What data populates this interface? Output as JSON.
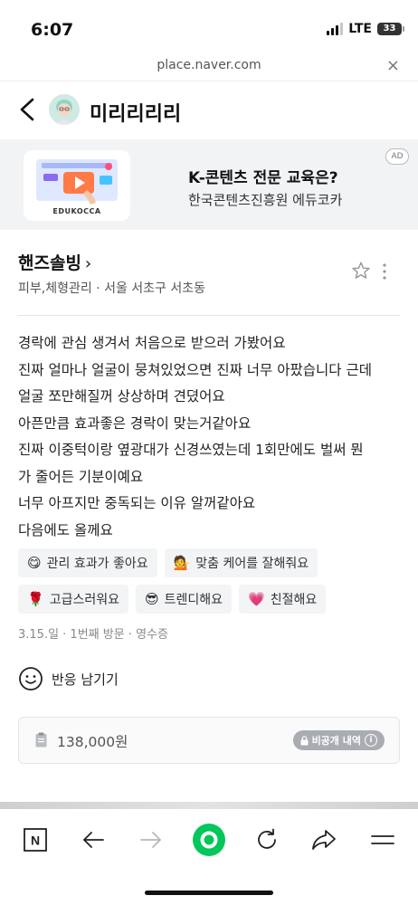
{
  "status_bar": {
    "time": "6:07",
    "network": "LTE",
    "battery": "33"
  },
  "browser": {
    "url": "place.naver.com",
    "close_label": "×"
  },
  "header": {
    "title": "미리리리리"
  },
  "ad": {
    "image_caption": "EDUKOCCA",
    "title": "K-콘텐츠 전문 교육은?",
    "subtitle": "한국콘텐츠진흥원 에듀코카",
    "badge": "AD"
  },
  "place": {
    "name": "핸즈솔빙",
    "chevron": "›",
    "category": "피부,체형관리 · 서울 서초구 서초동"
  },
  "review": {
    "lines": [
      "경락에 관심 생겨서 처음으로 받으러 가봤어요",
      "진짜 얼마나 얼굴이 뭉쳐있었으면 진짜 너무 아팠습니다 근데",
      "얼굴 쪼만해질꺼 상상하며 견뎠어요",
      "아픈만큼 효과좋은 경락이 맞는거같아요",
      "진짜 이중턱이랑 옆광대가 신경쓰였는데 1회만에도 벌써 뭔",
      "가 줄어든 기분이예요",
      "너무 아프지만 중독되는 이유 알꺼같아요",
      "다음에도 올께요"
    ]
  },
  "tags": [
    {
      "emoji": "😋",
      "label": "관리 효과가 좋아요"
    },
    {
      "emoji": "💁",
      "label": "맞춤 케어를 잘해줘요"
    },
    {
      "emoji": "🌹",
      "label": "고급스러워요"
    },
    {
      "emoji": "😎",
      "label": "트렌디해요"
    },
    {
      "emoji": "💗",
      "label": "친절해요"
    }
  ],
  "meta": "3.15.일 · 1번째 방문 · 영수증",
  "react_label": "반응 남기기",
  "receipt": {
    "price": "138,000원",
    "private_label": "비공개 내역",
    "info_label": "i"
  },
  "nav": {
    "n_label": "N"
  },
  "colors": {
    "accent_green": "#03c75a",
    "tag_bg": "#f3f4f6",
    "ad_bg": "#f2f3f5"
  },
  "icons": [
    "back-chevron-icon",
    "star-icon",
    "more-vertical-icon",
    "smiley-icon",
    "clipboard-icon",
    "lock-icon",
    "naver-n-icon",
    "arrow-left-icon",
    "arrow-right-icon",
    "naver-green-circle-icon",
    "refresh-icon",
    "share-icon",
    "menu-icon"
  ]
}
